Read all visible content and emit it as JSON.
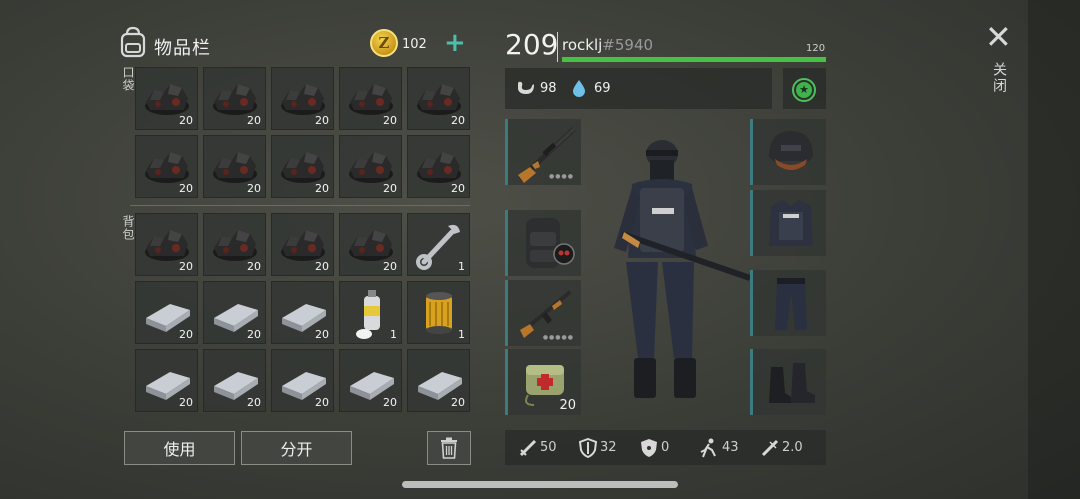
{
  "inventory": {
    "title": "物品栏",
    "coins": "102",
    "coin_symbol": "Z",
    "add_symbol": "+",
    "pocket_label": "口袋",
    "backpack_label": "背包",
    "pocket_slots": [
      {
        "item": "coal",
        "count": "20"
      },
      {
        "item": "coal",
        "count": "20"
      },
      {
        "item": "coal",
        "count": "20"
      },
      {
        "item": "coal",
        "count": "20"
      },
      {
        "item": "coal",
        "count": "20"
      },
      {
        "item": "coal",
        "count": "20"
      },
      {
        "item": "coal",
        "count": "20"
      },
      {
        "item": "coal",
        "count": "20"
      },
      {
        "item": "coal",
        "count": "20"
      },
      {
        "item": "coal",
        "count": "20"
      }
    ],
    "backpack_slots": [
      {
        "item": "coal",
        "count": "20"
      },
      {
        "item": "coal",
        "count": "20"
      },
      {
        "item": "coal",
        "count": "20"
      },
      {
        "item": "coal",
        "count": "20"
      },
      {
        "item": "wrench",
        "count": "1"
      },
      {
        "item": "iron-bar",
        "count": "20"
      },
      {
        "item": "iron-bar",
        "count": "20"
      },
      {
        "item": "iron-bar",
        "count": "20"
      },
      {
        "item": "spray-can",
        "count": "1"
      },
      {
        "item": "oil-filter",
        "count": "1"
      },
      {
        "item": "iron-bar",
        "count": "20"
      },
      {
        "item": "iron-bar",
        "count": "20"
      },
      {
        "item": "iron-bar",
        "count": "20"
      },
      {
        "item": "iron-bar",
        "count": "20"
      },
      {
        "item": "iron-bar",
        "count": "20"
      }
    ],
    "use_label": "使用",
    "split_label": "分开"
  },
  "player": {
    "level": "209",
    "name": "rocklj",
    "tag": "#5940",
    "hp_max": "120",
    "hp_fraction": 1.0,
    "food": "98",
    "water": "69"
  },
  "equipment": {
    "medkit_count": "20"
  },
  "stats": {
    "attack": "50",
    "armor": "32",
    "radiation": "0",
    "speed": "43",
    "crit": "2.0"
  },
  "close_label": "关闭",
  "colors": {
    "hp_bar": "#46c142",
    "accent": "#4cbfa8",
    "slot_edge": "#3c7c80"
  }
}
